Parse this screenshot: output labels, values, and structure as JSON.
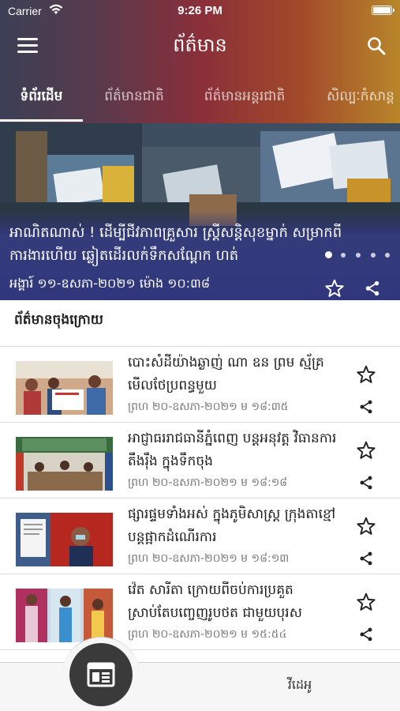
{
  "status_bar": {
    "carrier": "Carrier",
    "time": "9:26 PM"
  },
  "header": {
    "title": "ព័ត៌មាន"
  },
  "tabs": [
    {
      "label": "ទំព័រដើម"
    },
    {
      "label": "ព័ត៌មានជាតិ"
    },
    {
      "label": "ព័ត៌មានអន្តរជាតិ"
    },
    {
      "label": "សិល្បៈកំសាន្ត"
    }
  ],
  "hero": {
    "title": "អាណិតណាស់ ! ដើម្បីជីវភាពគ្រួសារ ស្រ្តីសន្តិសុខម្នាក់ សម្រាកពីការងារហើយ ឆ្លៀតដើរលក់ទឹកសណ្តែក ហត់",
    "date": "អង្គារ៍ ១១-ឧសភា-២០២១ ម៉ោង ១០:៣៨",
    "slide_count": 5,
    "active_slide": 1
  },
  "section": {
    "title": "ព័ត៌មានចុងក្រោយ"
  },
  "news": [
    {
      "title": "បោះសំដីយ៉ាងឆ្ងាញ់ ណា ឧន ព្រម ស្ម័គ្រមើលថែប្រពន្ធមួយ",
      "time": "ព្រហ ២០-ឧសភា-២០២១ ម ១៨:៣៥"
    },
    {
      "title": "អាជ្ញាធររាជធានីភ្នំពេញ បន្តអនុវត្ត វិធានការតឹងរ៉ឹង ក្នុងទឹកចុង",
      "time": "ព្រហ ២០-ឧសភា-២០២១ ម ១៨:១៨"
    },
    {
      "title": "ផ្សារផ្ទមទាំងអស់ ក្នុងភូមិសាស្រ្ត ក្រុងតាខ្មៅ បន្តផ្អាកដំណើរការ",
      "time": "ព្រហ ២០-ឧសភា-២០២១ ម ១៨:១៣"
    },
    {
      "title": "វ៉េត សារីតា ក្រោយពីចប់ការប្រគួត ស្រាប់តែបញ្ចេញរូបថត ជាមួយបុរស",
      "time": "ព្រហ ២០-ឧសភា-២០២១ ម ១៥:៥៤"
    }
  ],
  "bottom_nav": {
    "video_label": "វីដេអូ"
  },
  "colors": {
    "accent": "#8a2f3a",
    "hero_overlay": "#30347f",
    "fab": "#3a3a3a"
  },
  "icons": [
    "menu-icon",
    "search-icon",
    "star-icon",
    "share-icon",
    "newspaper-icon",
    "wifi-icon",
    "battery-icon"
  ]
}
